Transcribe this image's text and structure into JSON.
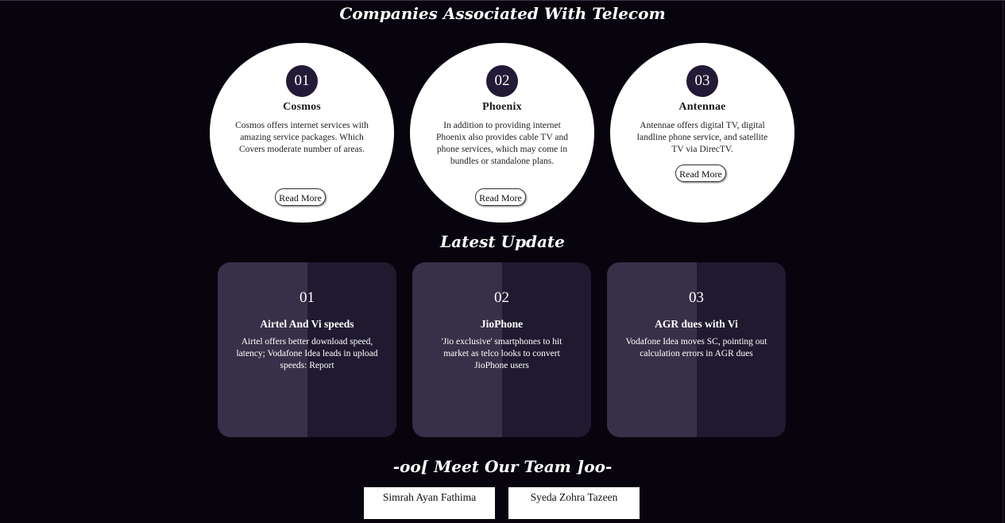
{
  "companies": {
    "title": "Companies Associated With Telecom",
    "items": [
      {
        "number": "01",
        "name": "Cosmos",
        "description": "Cosmos offers internet services with amazing service packages. Which Covers moderate number of areas.",
        "button": "Read More"
      },
      {
        "number": "02",
        "name": "Phoenix",
        "description": "In addition to providing internet Phoenix also provides cable TV and phone services, which may come in bundles or standalone plans.",
        "button": "Read More"
      },
      {
        "number": "03",
        "name": "Antennae",
        "description": "Antennae offers digital TV, digital landline phone service, and satellite TV via DirecTV.",
        "button": "Read More"
      }
    ]
  },
  "updates": {
    "title": "Latest Update",
    "items": [
      {
        "number": "01",
        "title": "Airtel And Vi speeds",
        "description": "Airtel offers better download speed, latency; Vodafone Idea leads in upload speeds: Report"
      },
      {
        "number": "02",
        "title": "JioPhone",
        "description": "'Jio exclusive' smartphones to hit market as telco looks to convert JioPhone users"
      },
      {
        "number": "03",
        "title": "AGR dues with Vi",
        "description": "Vodafone Idea moves SC, pointing out calculation errors in AGR dues"
      }
    ]
  },
  "team": {
    "title": "-oo[ Meet Our Team ]oo-",
    "members": [
      "Simrah Ayan Fathima",
      "Syeda Zohra Tazeen"
    ]
  },
  "colors": {
    "background": "#08040e",
    "circle": "#ffffff",
    "number_badge": "#221a36",
    "card_dark": "#201a30",
    "card_light": "#383048"
  }
}
